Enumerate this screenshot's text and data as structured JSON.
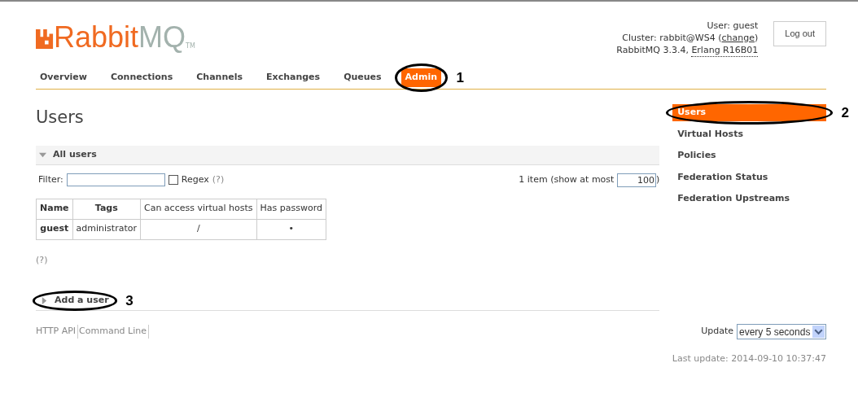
{
  "logo": {
    "primary": "Rabbit",
    "secondary": "MQ",
    "mark": "TM"
  },
  "header": {
    "user_label": "User: guest",
    "cluster_label": "Cluster: rabbit@WS4 (",
    "cluster_link": "change",
    "cluster_end": ")",
    "version": "RabbitMQ 3.3.4, ",
    "erlang": "Erlang R16B01",
    "logout": "Log out"
  },
  "nav": [
    {
      "label": "Overview",
      "selected": false
    },
    {
      "label": "Connections",
      "selected": false
    },
    {
      "label": "Channels",
      "selected": false
    },
    {
      "label": "Exchanges",
      "selected": false
    },
    {
      "label": "Queues",
      "selected": false
    },
    {
      "label": "Admin",
      "selected": true,
      "callout": "1"
    }
  ],
  "page_title": "Users",
  "all_users": {
    "title": "All users",
    "expanded": true,
    "filter_label": "Filter:",
    "regex": {
      "label": "Regex",
      "checked": false
    },
    "help": "(?)",
    "count": "1 item (show at most ",
    "max": "100",
    "count_end": ")"
  },
  "table": {
    "columns": [
      "Name",
      "Tags",
      "Can access virtual hosts",
      "Has password"
    ],
    "rows": [
      [
        "guest",
        "administrator",
        "/",
        "•"
      ]
    ]
  },
  "help_below": "(?)",
  "add_user": {
    "title": "Add a user",
    "expanded": false,
    "callout": "3"
  },
  "sidebar": [
    {
      "label": "Users",
      "selected": true,
      "callout": "2"
    },
    {
      "label": "Virtual Hosts",
      "selected": false
    },
    {
      "label": "Policies",
      "selected": false
    },
    {
      "label": "Federation Status",
      "selected": false
    },
    {
      "label": "Federation Upstreams",
      "selected": false
    }
  ],
  "footer": {
    "links": [
      "HTTP API",
      "Command Line"
    ],
    "update_label": "Update",
    "update_value": "every 5 seconds",
    "last_update": "Last update: 2014-09-10 10:37:47"
  }
}
